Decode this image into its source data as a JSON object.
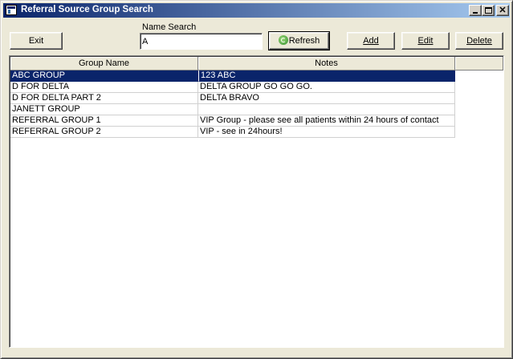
{
  "window": {
    "title": "Referral Source Group Search"
  },
  "toolbar": {
    "exit_label": "Exit",
    "name_search_label": "Name Search",
    "name_search_value": "A",
    "refresh_label": "Refresh",
    "add_label": "Add",
    "edit_label": "Edit",
    "delete_label": "Delete"
  },
  "grid": {
    "columns": [
      "Group Name",
      "Notes"
    ],
    "selected_row": 0,
    "rows": [
      {
        "name": "ABC GROUP",
        "notes": "123 ABC"
      },
      {
        "name": "D FOR DELTA",
        "notes": "DELTA GROUP GO GO GO."
      },
      {
        "name": "D FOR DELTA PART 2",
        "notes": "DELTA BRAVO"
      },
      {
        "name": "JANETT GROUP",
        "notes": ""
      },
      {
        "name": "REFERRAL GROUP 1",
        "notes": "VIP Group - please see all patients within 24 hours of contact"
      },
      {
        "name": "REFERRAL GROUP 2",
        "notes": "VIP - see in 24hours!"
      }
    ]
  },
  "colors": {
    "titlebar_start": "#0a246a",
    "titlebar_end": "#a6caf0",
    "selection": "#0a246a",
    "dialog_bg": "#ece9d8"
  },
  "icons": {
    "app": "window-app-icon",
    "refresh": "refresh-icon"
  }
}
